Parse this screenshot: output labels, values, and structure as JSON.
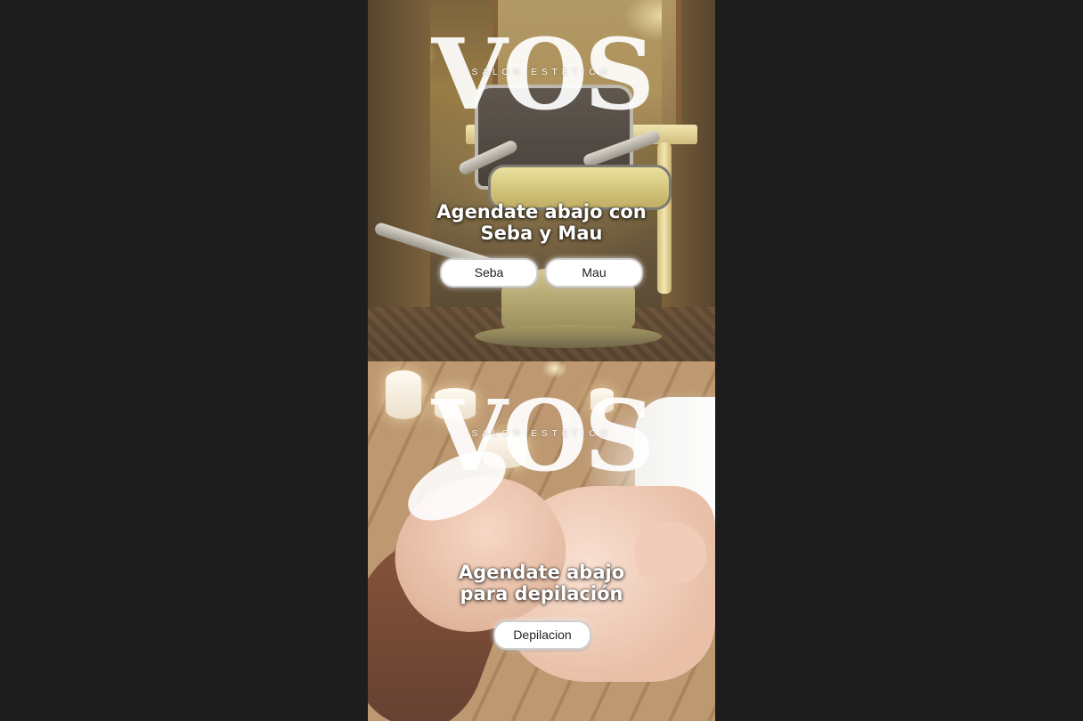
{
  "brand": {
    "logo_text": "VOS",
    "logo_subtitle": "SALON ESTETICO"
  },
  "sections": [
    {
      "heading": "Agendate abajo con Seba y Mau",
      "buttons": [
        {
          "label": "Seba"
        },
        {
          "label": "Mau"
        }
      ]
    },
    {
      "heading": "Agendate abajo para depilación",
      "buttons": [
        {
          "label": "Depilacion"
        }
      ]
    }
  ],
  "colors": {
    "page_background": "#1d1d1d",
    "button_background": "#ffffff",
    "heading_text": "#ffffff"
  }
}
